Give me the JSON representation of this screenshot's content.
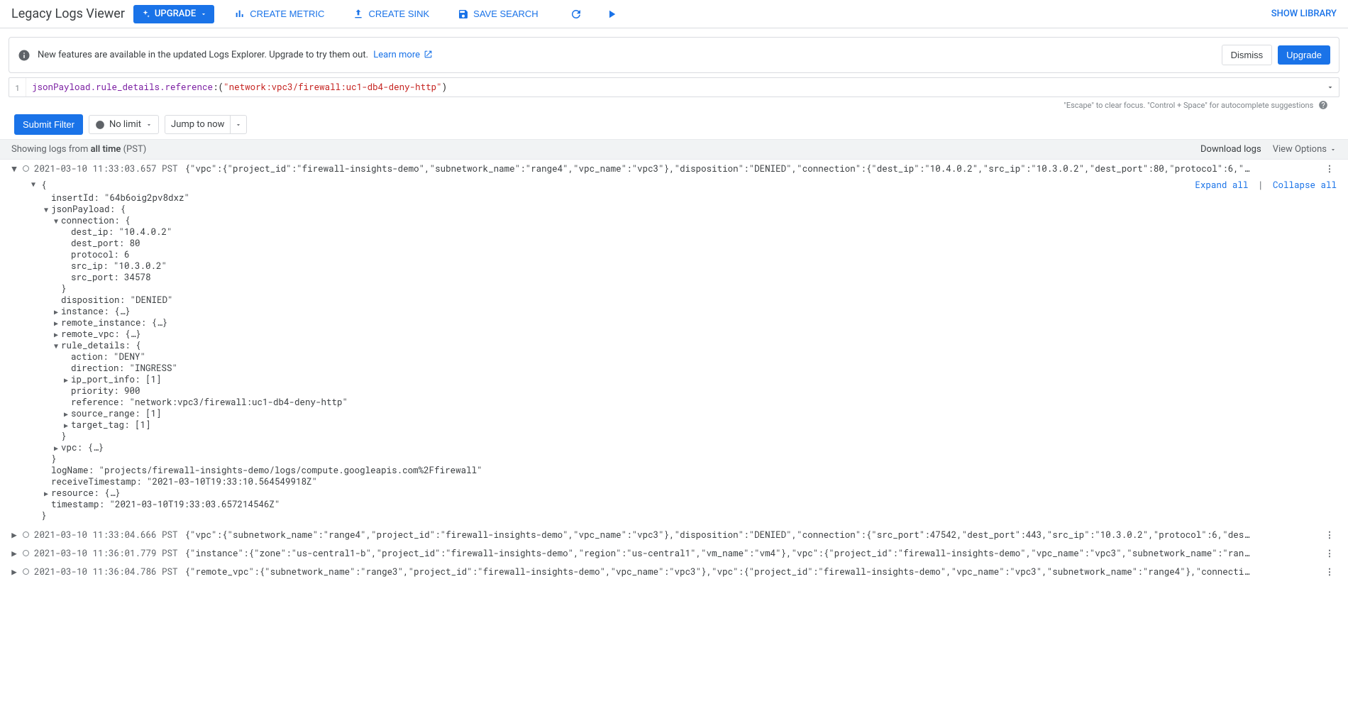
{
  "header": {
    "title": "Legacy Logs Viewer",
    "upgrade_chip": "UPGRADE",
    "buttons": {
      "create_metric": "CREATE METRIC",
      "create_sink": "CREATE SINK",
      "save_search": "SAVE SEARCH"
    },
    "show_library": "SHOW LIBRARY"
  },
  "banner": {
    "text": "New features are available in the updated Logs Explorer. Upgrade to try them out.",
    "learn_more": "Learn more",
    "dismiss": "Dismiss",
    "upgrade": "Upgrade"
  },
  "query": {
    "line_no": "1",
    "key": "jsonPayload.rule_details.reference",
    "op": ":(",
    "value": "\"network:vpc3/firewall:uc1-db4-deny-http\"",
    "close": ")",
    "hint": "\"Escape\" to clear focus. \"Control + Space\" for autocomplete suggestions"
  },
  "filter_row": {
    "submit": "Submit Filter",
    "no_limit": "No limit",
    "jump": "Jump to now"
  },
  "status": {
    "prefix": "Showing logs from ",
    "range": "all time",
    "tz": " (PST)",
    "download": "Download logs",
    "view_options": "View Options"
  },
  "expanded_links": {
    "expand": "Expand all",
    "collapse": "Collapse all"
  },
  "json": {
    "open": "{",
    "insertId": "insertId: \"64b6oig2pv8dxz\"",
    "jsonPayload": "jsonPayload: {",
    "connection": "connection: {",
    "dest_ip": "dest_ip: \"10.4.0.2\"",
    "dest_port": "dest_port: 80",
    "protocol": "protocol: 6",
    "src_ip": "src_ip: \"10.3.0.2\"",
    "src_port": "src_port: 34578",
    "conn_close": "}",
    "disposition": "disposition: \"DENIED\"",
    "instance": "instance: {…}",
    "remote_instance": "remote_instance: {…}",
    "remote_vpc": "remote_vpc: {…}",
    "rule_details": "rule_details: {",
    "action": "action: \"DENY\"",
    "direction": "direction: \"INGRESS\"",
    "ip_port_info": "ip_port_info: [1]",
    "priority": "priority: 900",
    "reference": "reference: \"network:vpc3/firewall:uc1-db4-deny-http\"",
    "source_range": "source_range: [1]",
    "target_tag": "target_tag: [1]",
    "rule_close": "}",
    "vpc": "vpc: {…}",
    "jp_close": "}",
    "logName": "logName: \"projects/firewall-insights-demo/logs/compute.googleapis.com%2Ffirewall\"",
    "receiveTimestamp": "receiveTimestamp: \"2021-03-10T19:33:10.564549918Z\"",
    "resource": "resource: {…}",
    "timestamp": "timestamp: \"2021-03-10T19:33:03.657214546Z\"",
    "close": "}"
  },
  "rows": [
    {
      "ts": "2021-03-10 11:33:03.657 PST",
      "payload": "{\"vpc\":{\"project_id\":\"firewall-insights-demo\",\"subnetwork_name\":\"range4\",\"vpc_name\":\"vpc3\"},\"disposition\":\"DENIED\",\"connection\":{\"dest_ip\":\"10.4.0.2\",\"src_ip\":\"10.3.0.2\",\"dest_port\":80,\"protocol\":6,\"…"
    },
    {
      "ts": "2021-03-10 11:33:04.666 PST",
      "payload": "{\"vpc\":{\"subnetwork_name\":\"range4\",\"project_id\":\"firewall-insights-demo\",\"vpc_name\":\"vpc3\"},\"disposition\":\"DENIED\",\"connection\":{\"src_port\":47542,\"dest_port\":443,\"src_ip\":\"10.3.0.2\",\"protocol\":6,\"des…"
    },
    {
      "ts": "2021-03-10 11:36:01.779 PST",
      "payload": "{\"instance\":{\"zone\":\"us-central1-b\",\"project_id\":\"firewall-insights-demo\",\"region\":\"us-central1\",\"vm_name\":\"vm4\"},\"vpc\":{\"project_id\":\"firewall-insights-demo\",\"vpc_name\":\"vpc3\",\"subnetwork_name\":\"ran…"
    },
    {
      "ts": "2021-03-10 11:36:04.786 PST",
      "payload": "{\"remote_vpc\":{\"subnetwork_name\":\"range3\",\"project_id\":\"firewall-insights-demo\",\"vpc_name\":\"vpc3\"},\"vpc\":{\"project_id\":\"firewall-insights-demo\",\"vpc_name\":\"vpc3\",\"subnetwork_name\":\"range4\"},\"connecti…"
    }
  ]
}
